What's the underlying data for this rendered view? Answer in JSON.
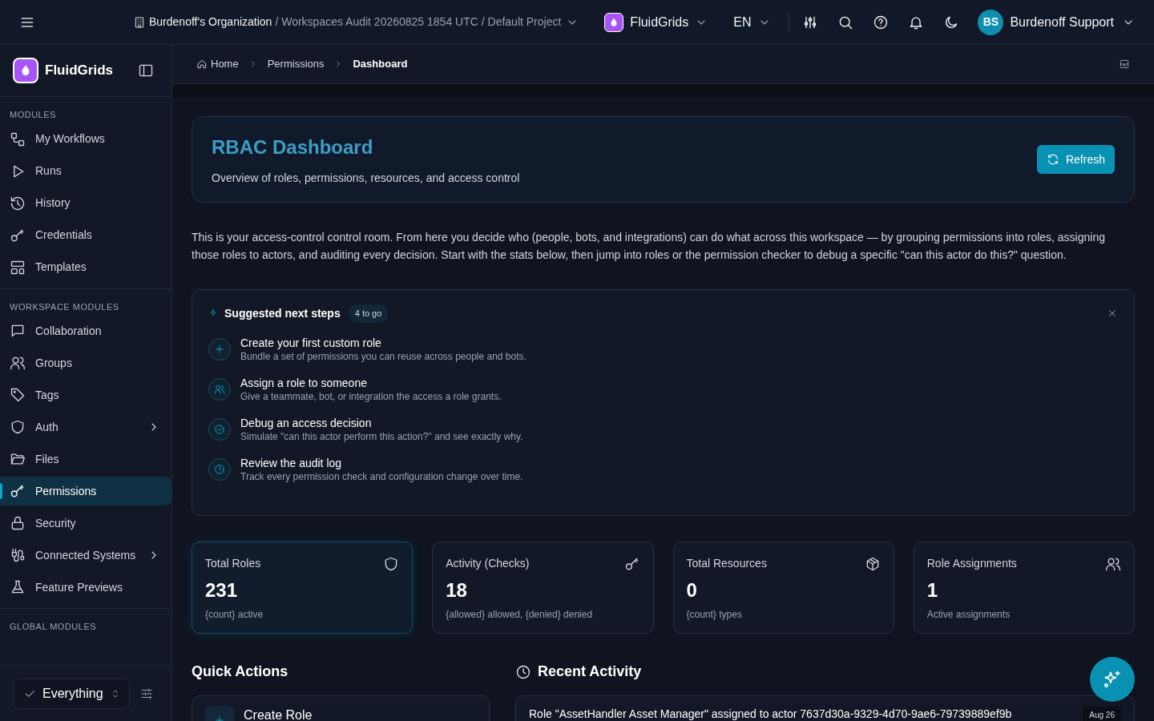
{
  "header": {
    "org": "Burdenoff's Organization",
    "path": "/ Workspaces Audit 20260825 1854 UTC / Default Project",
    "app": "FluidGrids",
    "language": "EN",
    "user": {
      "initials": "BS",
      "name": "Burdenoff Support"
    }
  },
  "sidebar": {
    "brand": "FluidGrids",
    "sections": [
      {
        "title": "MODULES",
        "items": [
          {
            "label": "My Workflows",
            "selected": false,
            "expandable": false
          },
          {
            "label": "Runs",
            "selected": false,
            "expandable": false
          },
          {
            "label": "History",
            "selected": false,
            "expandable": false
          },
          {
            "label": "Credentials",
            "selected": false,
            "expandable": false
          },
          {
            "label": "Templates",
            "selected": false,
            "expandable": false
          }
        ]
      },
      {
        "title": "WORKSPACE MODULES",
        "items": [
          {
            "label": "Collaboration",
            "selected": false,
            "expandable": false
          },
          {
            "label": "Groups",
            "selected": false,
            "expandable": false
          },
          {
            "label": "Tags",
            "selected": false,
            "expandable": false
          },
          {
            "label": "Auth",
            "selected": false,
            "expandable": true
          },
          {
            "label": "Files",
            "selected": false,
            "expandable": false
          },
          {
            "label": "Permissions",
            "selected": true,
            "expandable": false
          },
          {
            "label": "Security",
            "selected": false,
            "expandable": false
          },
          {
            "label": "Connected Systems",
            "selected": false,
            "expandable": true
          },
          {
            "label": "Feature Previews",
            "selected": false,
            "expandable": false
          }
        ]
      },
      {
        "title": "GLOBAL MODULES"
      }
    ],
    "filter": "Everything"
  },
  "breadcrumbs": [
    {
      "label": "Home",
      "current": false
    },
    {
      "label": "Permissions",
      "current": false
    },
    {
      "label": "Dashboard",
      "current": true
    }
  ],
  "page": {
    "title": "RBAC Dashboard",
    "subtitle": "Overview of roles, permissions, resources, and access control",
    "refresh": "Refresh",
    "intro": "This is your access-control control room. From here you decide who (people, bots, and integrations) can do what across this workspace — by grouping permissions into roles, assigning those roles to actors, and auditing every decision. Start with the stats below, then jump into roles or the permission checker to debug a specific \"can this actor do this?\" question."
  },
  "next_steps": {
    "title": "Suggested next steps",
    "badge": "4 to go",
    "steps": [
      {
        "kind": "plus",
        "title": "Create your first custom role",
        "description": "Bundle a set of permissions you can reuse across people and bots."
      },
      {
        "kind": "users",
        "title": "Assign a role to someone",
        "description": "Give a teammate, bot, or integration the access a role grants."
      },
      {
        "kind": "check",
        "title": "Debug an access decision",
        "description": "Simulate \"can this actor perform this action?\" and see exactly why."
      },
      {
        "kind": "clock",
        "title": "Review the audit log",
        "description": "Track every permission check and configuration change over time."
      }
    ]
  },
  "stats": [
    {
      "kind": "shield",
      "label": "Total Roles",
      "value": "231",
      "note": "{count} active",
      "selected": true
    },
    {
      "kind": "key",
      "label": "Activity (Checks)",
      "value": "18",
      "note": "{allowed} allowed, {denied} denied",
      "selected": false
    },
    {
      "kind": "box",
      "label": "Total Resources",
      "value": "0",
      "note": "{count} types",
      "selected": false
    },
    {
      "kind": "users",
      "label": "Role Assignments",
      "value": "1",
      "note": "Active assignments",
      "selected": false
    }
  ],
  "quick_actions": {
    "title": "Quick Actions",
    "items": [
      {
        "label": "Create Role"
      }
    ]
  },
  "recent_activity": {
    "title": "Recent Activity",
    "items": [
      {
        "text": "Role \"AssetHandler Asset Manager\" assigned to actor 7637d30a-9329-4d70-9ae6-79739889ef9b",
        "date": "Aug 26"
      }
    ]
  }
}
